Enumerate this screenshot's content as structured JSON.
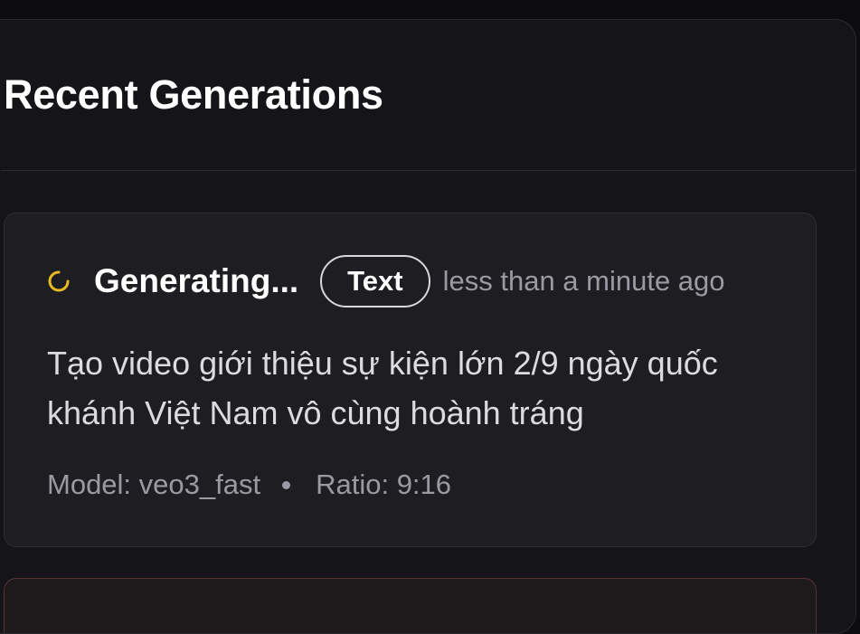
{
  "header": {
    "title": "Recent Generations"
  },
  "generations": [
    {
      "status": "Generating...",
      "type": "Text",
      "time": "less than a minute ago",
      "prompt": "Tạo video giới thiệu sự kiện lớn 2/9 ngày quốc khánh Việt Nam vô cùng hoành tráng",
      "model": "Model: veo3_fast",
      "ratio": "Ratio: 9:16"
    }
  ],
  "colors": {
    "spinner": "#e8b923",
    "next_card_border": "#5a3236"
  },
  "icons": {
    "status": "loading-spinner-icon",
    "separator": "bullet-dot-icon"
  }
}
